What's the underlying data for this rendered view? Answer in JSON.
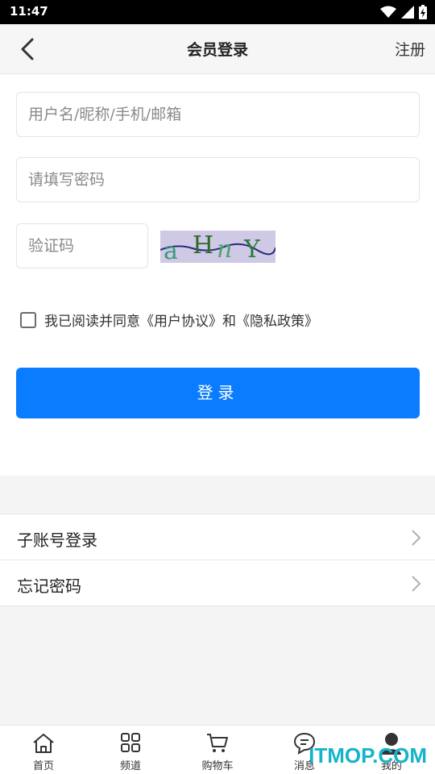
{
  "status_bar": {
    "time": "11:47"
  },
  "app_bar": {
    "title": "会员登录",
    "register": "注册"
  },
  "form": {
    "username_placeholder": "用户名/昵称/手机/邮箱",
    "password_placeholder": "请填写密码",
    "captcha_placeholder": "验证码",
    "captcha_text": "aHnY",
    "agree_prefix": "我已阅读并同意",
    "agree_link1": "《用户协议》",
    "agree_and": "和",
    "agree_link2": "《隐私政策》",
    "login_label": "登录"
  },
  "links": [
    {
      "label": "子账号登录"
    },
    {
      "label": "忘记密码"
    }
  ],
  "tabs": [
    {
      "label": "首页",
      "icon": "home-icon"
    },
    {
      "label": "频道",
      "icon": "grid-icon"
    },
    {
      "label": "购物车",
      "icon": "cart-icon"
    },
    {
      "label": "消息",
      "icon": "message-icon"
    },
    {
      "label": "我的",
      "icon": "user-icon"
    }
  ],
  "watermark": "ITMOP.COM",
  "colors": {
    "primary": "#0a7cff",
    "watermark": "#15b4c9"
  }
}
